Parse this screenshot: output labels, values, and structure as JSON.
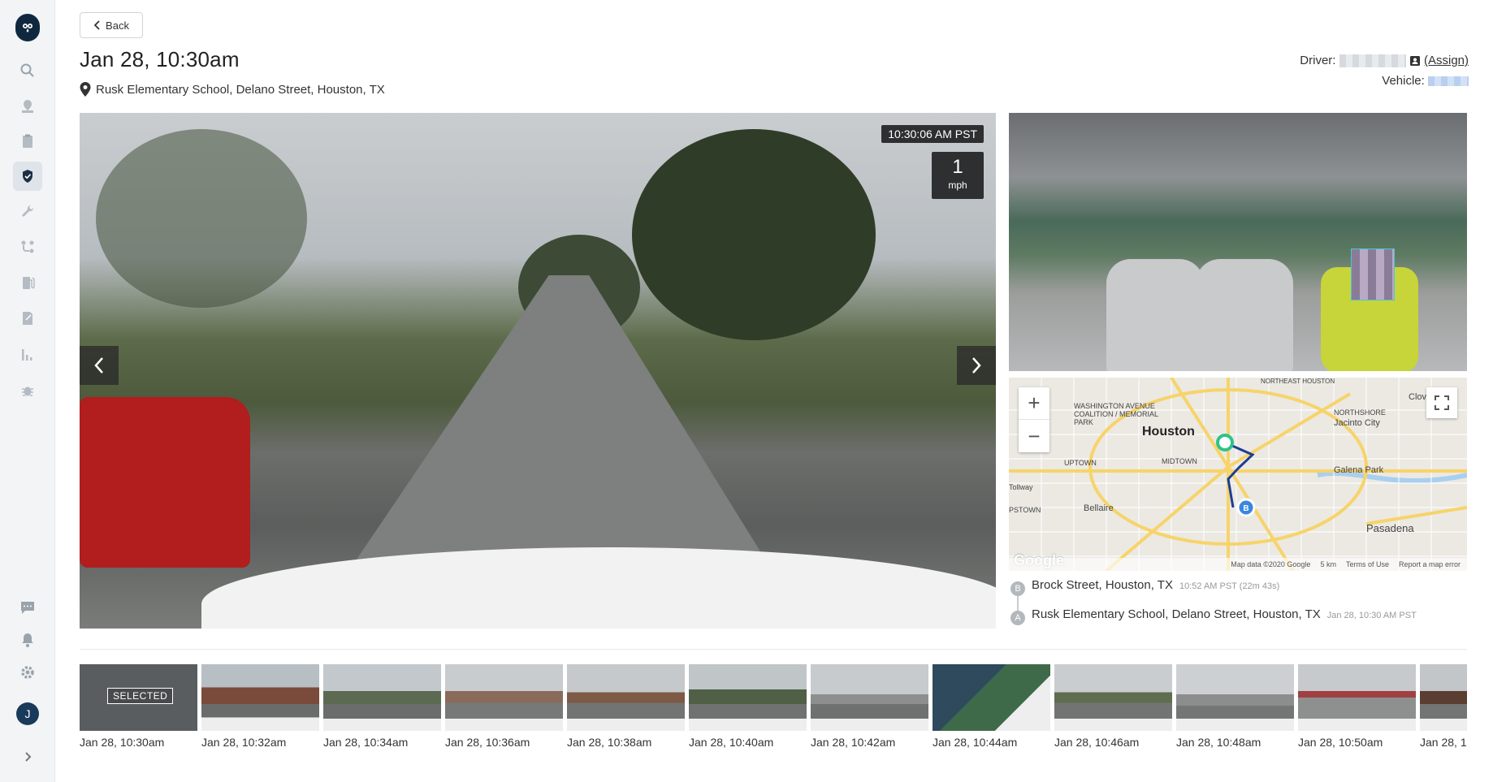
{
  "nav": {
    "back_label": "Back",
    "icons": [
      "search-icon",
      "map-pin-icon",
      "clipboard-icon",
      "shield-icon",
      "wrench-icon",
      "route-icon",
      "fuel-icon",
      "document-icon",
      "bar-chart-icon",
      "bug-icon"
    ],
    "bottom_icons": [
      "chat-icon",
      "bell-icon",
      "gear-icon"
    ],
    "avatar_initial": "J",
    "expand_icon": "chevron-right-icon"
  },
  "header": {
    "title": "Jan 28, 10:30am",
    "location": "Rusk Elementary School, Delano Street, Houston, TX",
    "driver_label": "Driver:",
    "assign_label": "(Assign)",
    "vehicle_label": "Vehicle:"
  },
  "video": {
    "timestamp": "10:30:06 AM PST",
    "speed_value": "1",
    "speed_unit": "mph"
  },
  "map": {
    "city_houston": "Houston",
    "labels": [
      "WASHINGTON AVENUE COALITION / MEMORIAL PARK",
      "NORTHSHORE",
      "Jacinto City",
      "UPTOWN",
      "MIDTOWN",
      "Galena Park",
      "Bellaire",
      "Pasadena",
      "Tollway",
      "PSTOWN",
      "NORTHEAST HOUSTON",
      "Clov"
    ],
    "footer_data": "Map data ©2020 Google",
    "footer_scale": "5 km",
    "footer_terms": "Terms of Use",
    "footer_report": "Report a map error",
    "google": "Google"
  },
  "route": {
    "end": {
      "badge": "B",
      "place": "Brock Street, Houston, TX",
      "meta": "10:52 AM PST (22m 43s)"
    },
    "start": {
      "badge": "A",
      "place": "Rusk Elementary School, Delano Street, Houston, TX",
      "meta": "Jan 28, 10:30 AM PST"
    }
  },
  "thumbnails": [
    {
      "label": "Jan 28, 10:30am",
      "selected": true,
      "selected_text": "SELECTED"
    },
    {
      "label": "Jan 28, 10:32am"
    },
    {
      "label": "Jan 28, 10:34am"
    },
    {
      "label": "Jan 28, 10:36am"
    },
    {
      "label": "Jan 28, 10:38am"
    },
    {
      "label": "Jan 28, 10:40am"
    },
    {
      "label": "Jan 28, 10:42am"
    },
    {
      "label": "Jan 28, 10:44am"
    },
    {
      "label": "Jan 28, 10:46am"
    },
    {
      "label": "Jan 28, 10:48am"
    },
    {
      "label": "Jan 28, 10:50am"
    },
    {
      "label": "Jan 28, 1"
    }
  ]
}
